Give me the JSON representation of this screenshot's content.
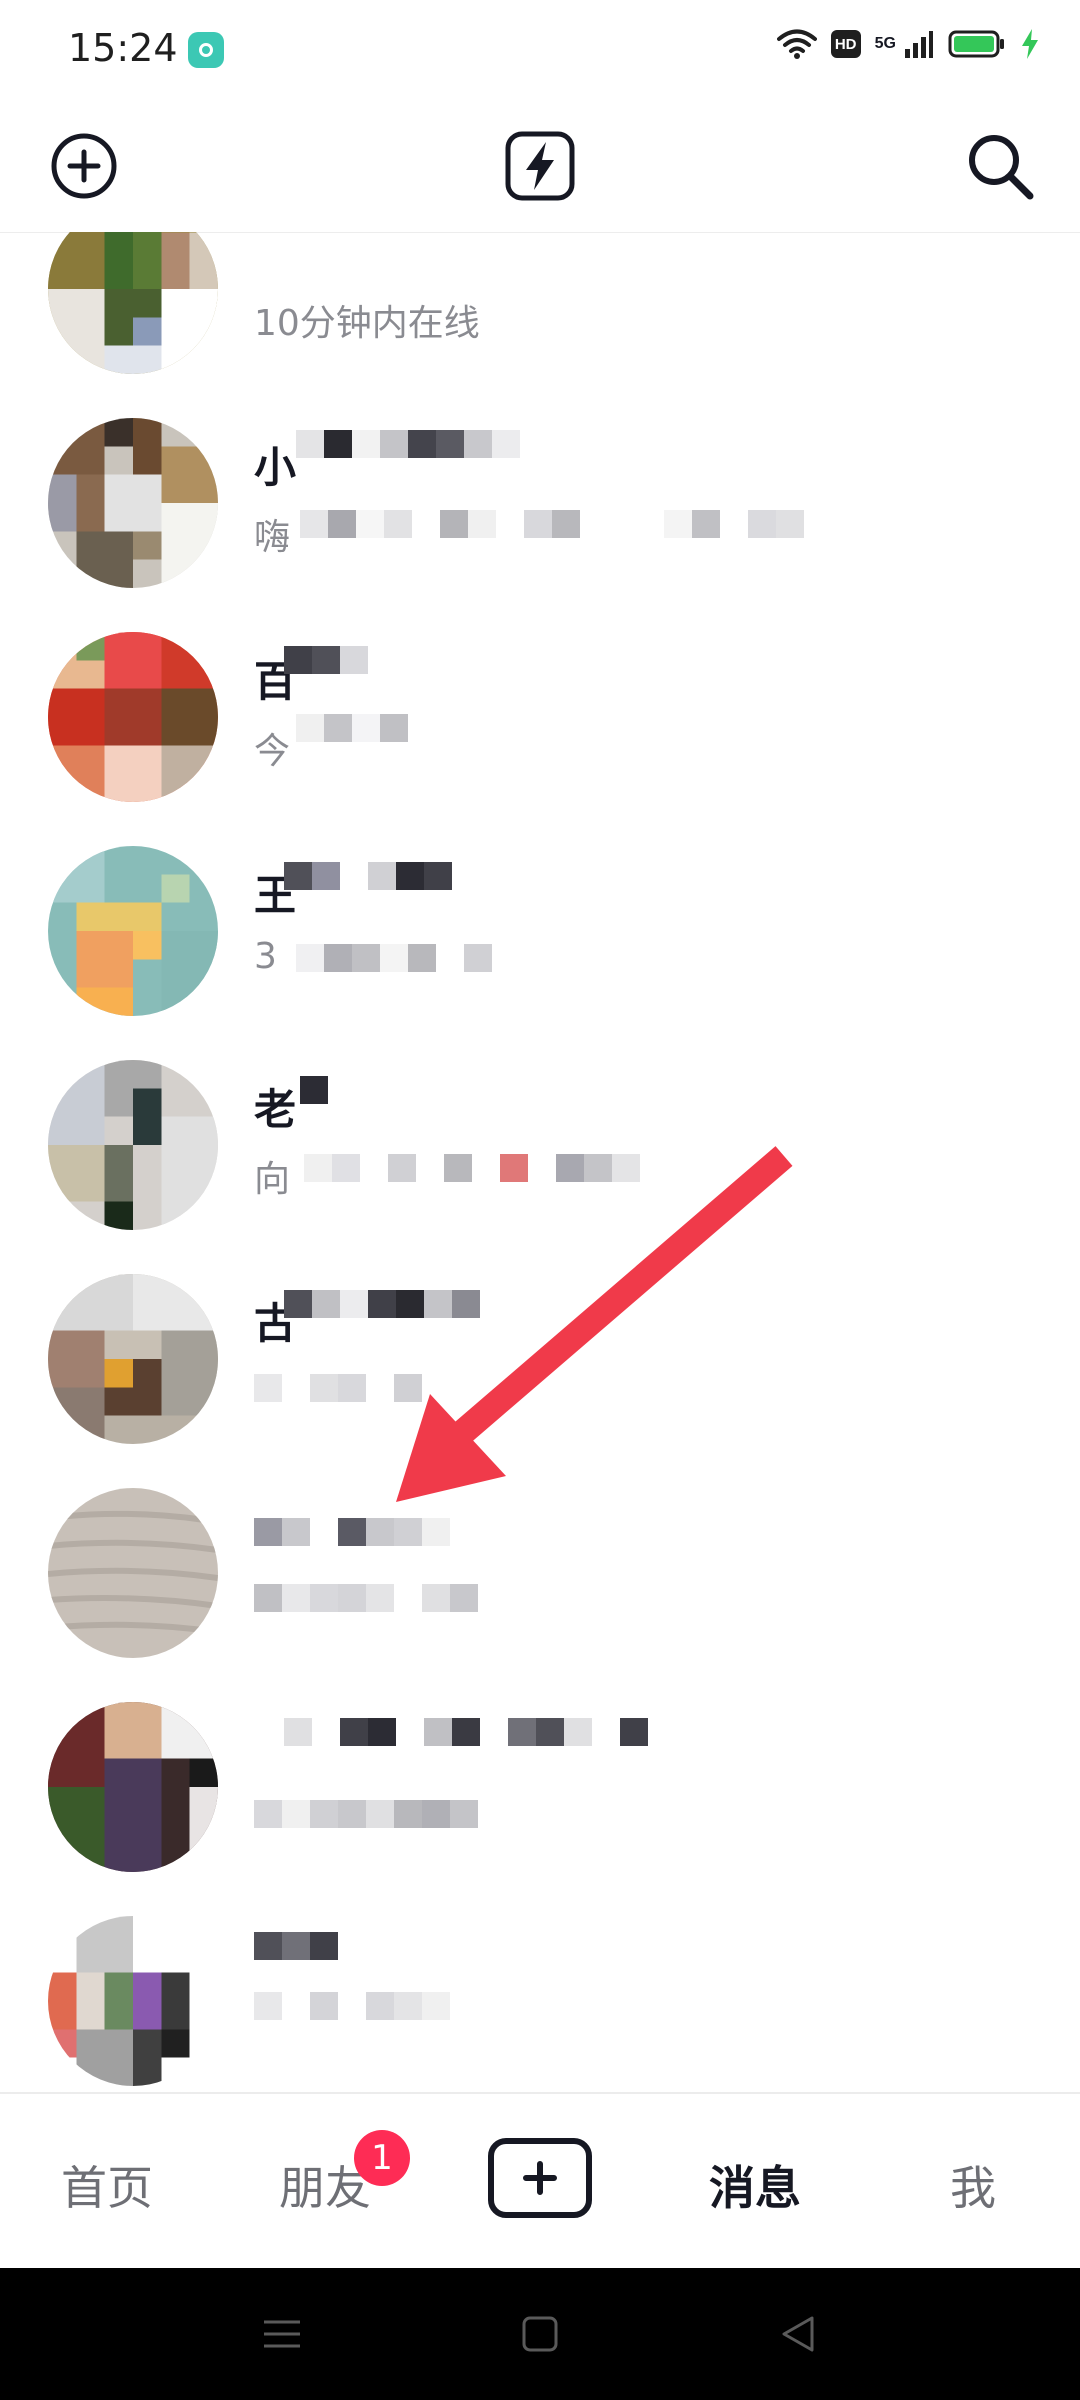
{
  "status_bar": {
    "time": "15:24",
    "hd_label": "HD",
    "signal_label": "5G",
    "icons": [
      "app-notification-icon",
      "wifi-icon",
      "hd-icon",
      "cellular-signal-icon",
      "battery-icon",
      "charging-icon"
    ],
    "battery_level_percent": 100
  },
  "top_bar": {
    "left_icon": "add-friend-icon",
    "center_icon": "flash-icon",
    "right_icon": "search-icon"
  },
  "chat_list": {
    "items": [
      {
        "name": "",
        "subtitle": "10分钟内在线",
        "avatar": "avatar-1"
      },
      {
        "name": "小",
        "subtitle": "嗨",
        "avatar": "avatar-2"
      },
      {
        "name": "百",
        "subtitle": "今",
        "avatar": "avatar-3"
      },
      {
        "name": "王",
        "subtitle": "3",
        "avatar": "avatar-4"
      },
      {
        "name": "老",
        "subtitle": "向",
        "avatar": "avatar-5"
      },
      {
        "name": "古",
        "subtitle": "",
        "avatar": "avatar-6"
      },
      {
        "name": "",
        "subtitle": "",
        "avatar": "avatar-7"
      },
      {
        "name": "",
        "subtitle": "",
        "avatar": "avatar-8"
      },
      {
        "name": "",
        "subtitle": "",
        "avatar": "avatar-9"
      }
    ]
  },
  "annotation": {
    "arrow_color": "#f03a4a"
  },
  "bottom_nav": {
    "home": "首页",
    "friends": "朋友",
    "friends_badge": "1",
    "create_icon": "plus-icon",
    "messages": "消息",
    "me": "我",
    "active_color": "#161823",
    "inactive_color": "#6e6f75",
    "badge_color": "#fe2c55"
  },
  "system_nav": {
    "icons": [
      "menu-icon",
      "home-square-icon",
      "back-triangle-icon"
    ]
  }
}
